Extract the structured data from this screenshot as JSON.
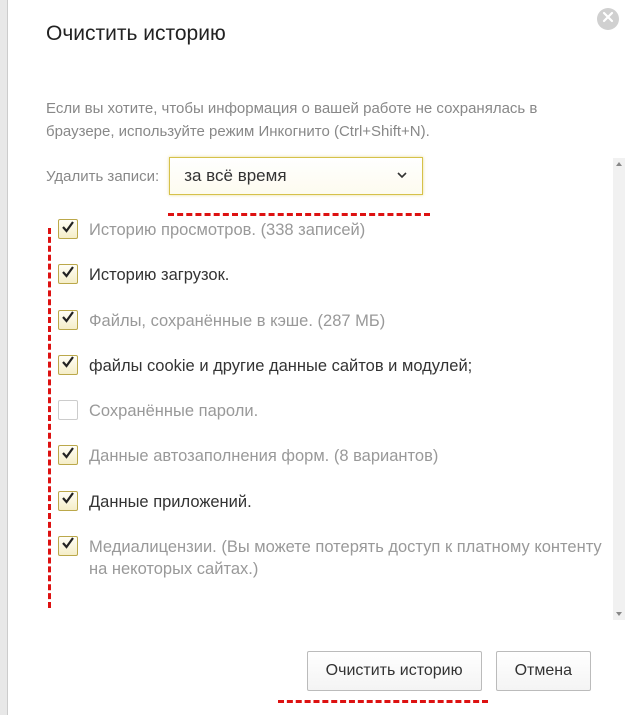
{
  "title": "Очистить историю",
  "intro": "Если вы хотите, чтобы информация о вашей работе не сохранялась в браузере, используйте режим Инкогнито (Ctrl+Shift+N).",
  "delete_label": "Удалить записи:",
  "time_range_selected": "за всё время",
  "options": [
    {
      "label": "Историю просмотров.",
      "hint": "(338 записей)",
      "checked": true,
      "label_muted": true
    },
    {
      "label": "Историю загрузок.",
      "hint": "",
      "checked": true,
      "label_muted": false
    },
    {
      "label": "Файлы, сохранённые в кэше.",
      "hint": "(287 МБ)",
      "checked": true,
      "label_muted": true
    },
    {
      "label": "файлы cookie и другие данные сайтов и модулей;",
      "hint": "",
      "checked": true,
      "label_muted": false
    },
    {
      "label": "Сохранённые пароли.",
      "hint": "",
      "checked": false,
      "label_muted": true
    },
    {
      "label": "Данные автозаполнения форм.",
      "hint": "(8 вариантов)",
      "checked": true,
      "label_muted": true
    },
    {
      "label": "Данные приложений.",
      "hint": "",
      "checked": true,
      "label_muted": false
    },
    {
      "label": "Медиалицензии.",
      "hint": "(Вы можете потерять доступ к платному контенту на некоторых сайтах.)",
      "checked": true,
      "label_muted": true
    }
  ],
  "buttons": {
    "clear": "Очистить историю",
    "cancel": "Отмена"
  }
}
